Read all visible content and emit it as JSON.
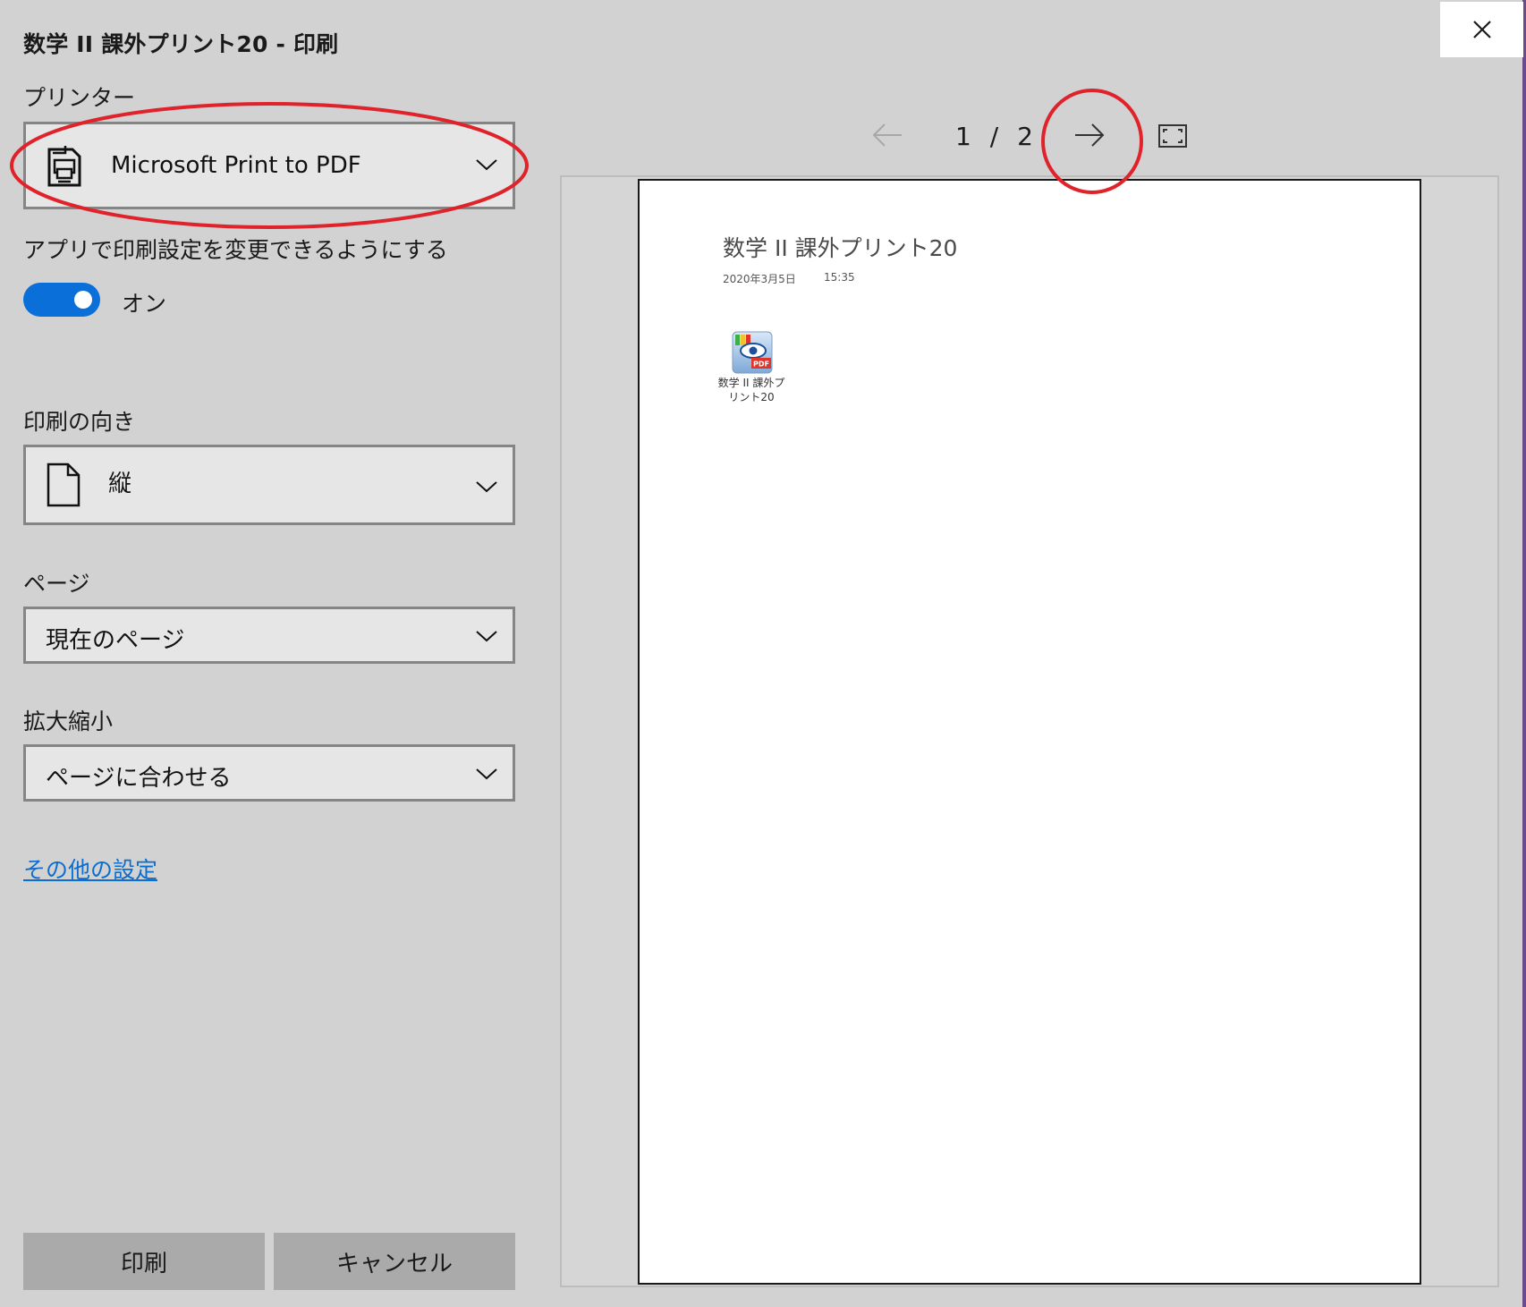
{
  "window": {
    "title": "数学 II 課外プリント20 - 印刷"
  },
  "printer": {
    "label": "プリンター",
    "selected": "Microsoft Print to PDF"
  },
  "app_settings": {
    "label": "アプリで印刷設定を変更できるようにする",
    "toggle_state": "オン",
    "toggle_on": true
  },
  "orientation": {
    "label": "印刷の向き",
    "selected": "縦"
  },
  "pages": {
    "label": "ページ",
    "selected": "現在のページ"
  },
  "scale": {
    "label": "拡大縮小",
    "selected": "ページに合わせる"
  },
  "more_settings_link": "その他の設定",
  "buttons": {
    "print": "印刷",
    "cancel": "キャンセル"
  },
  "preview": {
    "current_page": "1",
    "separator": "/",
    "total_pages": "2",
    "page": {
      "title": "数学 II 課外プリント20",
      "date": "2020年3月5日",
      "time": "15:35",
      "attachment_name": "数学 II 課外プリント20",
      "attachment_icon_text": "PDF"
    }
  },
  "colors": {
    "background": "#d2d2d2",
    "toggle_on": "#0a6fd8",
    "link": "#0a6ed1",
    "annotation_red": "#e0222a",
    "button": "#aaaaaa"
  },
  "icons": {
    "printer": "printer-icon",
    "orientation": "portrait-page-icon",
    "chevron": "chevron-down-icon",
    "prev": "arrow-left-icon",
    "next": "arrow-right-icon",
    "fullscreen": "fullscreen-icon",
    "close": "close-icon"
  }
}
